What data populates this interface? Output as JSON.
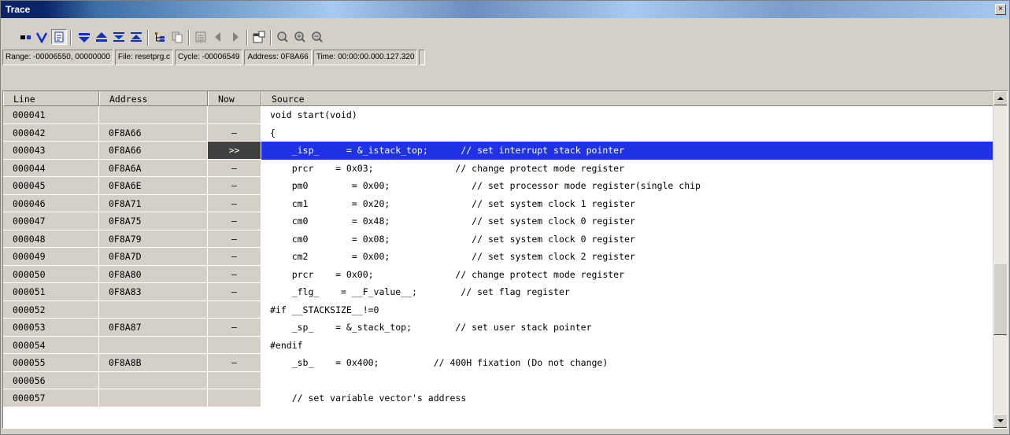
{
  "window": {
    "title": "Trace",
    "close_glyph": "×"
  },
  "toolbar": {
    "buttons": [
      {
        "icon": "record-icon"
      },
      {
        "icon": "filter-icon"
      },
      {
        "icon": "source-mode-icon"
      },
      {
        "icon": "find-first-icon"
      },
      {
        "icon": "find-last-icon"
      },
      {
        "icon": "find-prev-icon"
      },
      {
        "icon": "find-next-icon"
      },
      {
        "icon": "tree-icon"
      },
      {
        "icon": "copy-icon"
      },
      {
        "icon": "list-icon"
      },
      {
        "icon": "step-back-icon"
      },
      {
        "icon": "step-forward-icon"
      },
      {
        "icon": "properties-icon"
      },
      {
        "icon": "zoom-icon"
      },
      {
        "icon": "zoom-in-icon"
      },
      {
        "icon": "zoom-out-icon"
      }
    ]
  },
  "status": {
    "range": "Range: -00006550, 00000000",
    "file": "File: resetprg.c",
    "cycle": "Cycle: -00006549",
    "address": "Address: 0F8A66",
    "time": "Time: 00:00:00.000.127.320"
  },
  "columns": {
    "line": "Line",
    "address": "Address",
    "now": "Now",
    "source": "Source"
  },
  "rows": [
    {
      "line": "000041",
      "address": "",
      "now": "",
      "source": "void start(void)"
    },
    {
      "line": "000042",
      "address": "0F8A66",
      "now": "–",
      "source": "{"
    },
    {
      "line": "000043",
      "address": "0F8A66",
      "now": ">>",
      "source": "    _isp_     = &_istack_top;      // set interrupt stack pointer"
    },
    {
      "line": "000044",
      "address": "0F8A6A",
      "now": "–",
      "source": "    prcr    = 0x03;               // change protect mode register"
    },
    {
      "line": "000045",
      "address": "0F8A6E",
      "now": "–",
      "source": "    pm0        = 0x00;               // set processor mode register(single chip"
    },
    {
      "line": "000046",
      "address": "0F8A71",
      "now": "–",
      "source": "    cm1        = 0x20;               // set system clock 1 register"
    },
    {
      "line": "000047",
      "address": "0F8A75",
      "now": "–",
      "source": "    cm0        = 0x48;               // set system clock 0 register"
    },
    {
      "line": "000048",
      "address": "0F8A79",
      "now": "–",
      "source": "    cm0        = 0x08;               // set system clock 0 register"
    },
    {
      "line": "000049",
      "address": "0F8A7D",
      "now": "–",
      "source": "    cm2        = 0x00;               // set system clock 2 register"
    },
    {
      "line": "000050",
      "address": "0F8A80",
      "now": "–",
      "source": "    prcr    = 0x00;               // change protect mode register"
    },
    {
      "line": "000051",
      "address": "0F8A83",
      "now": "–",
      "source": "    _flg_    = __F_value__;        // set flag register"
    },
    {
      "line": "000052",
      "address": "",
      "now": "",
      "source": "#if __STACKSIZE__!=0"
    },
    {
      "line": "000053",
      "address": "0F8A87",
      "now": "–",
      "source": "    _sp_    = &_stack_top;        // set user stack pointer"
    },
    {
      "line": "000054",
      "address": "",
      "now": "",
      "source": "#endif"
    },
    {
      "line": "000055",
      "address": "0F8A8B",
      "now": "–",
      "source": "    _sb_    = 0x400;          // 400H fixation (Do not change)"
    },
    {
      "line": "000056",
      "address": "",
      "now": "",
      "source": ""
    },
    {
      "line": "000057",
      "address": "",
      "now": "",
      "source": "    // set variable vector's address"
    }
  ],
  "highlight_row": 2,
  "colors": {
    "title_bar": "#0a246a",
    "highlight": "#1f32e6",
    "face": "#d4d0c8"
  }
}
